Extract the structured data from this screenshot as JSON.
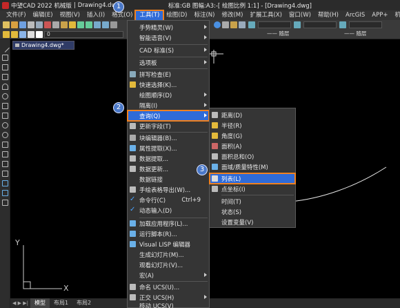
{
  "title": {
    "app": "中望CAD 2022 机械版",
    "doc": "Drawing4.dwg",
    "standard": "标准:GB 图幅:A3:-[ 绘图比例 1:1] - [Drawing4.dwg]"
  },
  "menubar": {
    "items": [
      "文件(F)",
      "编辑(E)",
      "视图(V)",
      "插入(I)",
      "格式(O)",
      "工具(T)",
      "绘图(D)",
      "标注(N)",
      "修改(M)",
      "扩展工具(X)",
      "窗口(W)",
      "帮助(H)",
      "ArcGIS",
      "APP+",
      "机械(J)"
    ]
  },
  "toolbar": {
    "layer_value": "0",
    "linetype_1": "—— 随层",
    "linetype_2": "—— 随层"
  },
  "doc_tab": "Drawing4.dwg*",
  "ucs": {
    "y": "Y",
    "x": "X"
  },
  "bottom_tabs": [
    "模型",
    "布局1",
    "布局2"
  ],
  "tools_menu": {
    "items": [
      {
        "label": "手势精灵(W)",
        "submenu": true
      },
      {
        "label": "智能语音(V)",
        "submenu": true
      },
      {
        "label": "CAD 标准(S)",
        "submenu": true
      },
      {
        "label": "选项板",
        "submenu": true
      },
      {
        "label": "拼写检查(E)"
      },
      {
        "label": "快速选择(K)..."
      },
      {
        "label": "绘图顺序(D)",
        "submenu": true
      },
      {
        "label": "隔离(I)",
        "submenu": true
      },
      {
        "label": "查询(Q)",
        "submenu": true
      },
      {
        "label": "更新字段(T)"
      },
      {
        "label": "块编辑器(B)..."
      },
      {
        "label": "属性提取(X)..."
      },
      {
        "label": "数据提取..."
      },
      {
        "label": "数据更新..."
      },
      {
        "label": "数据链接"
      },
      {
        "label": "手绘表格导出(W)..."
      },
      {
        "label": "命令行(C)",
        "shortcut": "Ctrl+9"
      },
      {
        "label": "动态输入(D)"
      },
      {
        "label": "加载应用程序(L)..."
      },
      {
        "label": "运行脚本(R)..."
      },
      {
        "label": "Visual LISP 编辑器"
      },
      {
        "label": "生成幻灯片(M)..."
      },
      {
        "label": "观看幻灯片(V)..."
      },
      {
        "label": "宏(A)",
        "submenu": true
      },
      {
        "label": "命名 UCS(U)..."
      },
      {
        "label": "正交 UCS(H)",
        "submenu": true
      },
      {
        "label": "移动 UCS(V)"
      }
    ]
  },
  "query_menu": {
    "items": [
      {
        "label": "距离(D)"
      },
      {
        "label": "半径(R)"
      },
      {
        "label": "角度(G)"
      },
      {
        "label": "面积(A)"
      },
      {
        "label": "面积总和(O)"
      },
      {
        "label": "面域/质量特性(M)"
      },
      {
        "label": "列表(L)"
      },
      {
        "label": "点坐标(I)"
      },
      {
        "label": "时间(T)"
      },
      {
        "label": "状态(S)"
      },
      {
        "label": "设置变量(V)"
      }
    ]
  },
  "badges": [
    "1",
    "2",
    "3"
  ],
  "colors": {
    "highlight": "#2f6bd8",
    "outline": "#f0811f",
    "badge": "#4a78c8"
  }
}
